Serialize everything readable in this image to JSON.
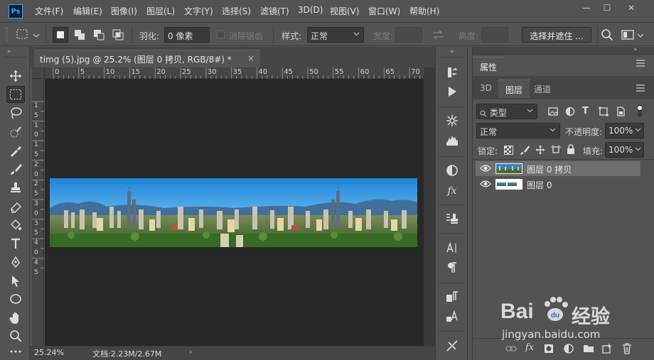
{
  "app": {
    "logo": "Ps"
  },
  "menu": [
    "文件(F)",
    "编辑(E)",
    "图像(I)",
    "图层(L)",
    "文字(Y)",
    "选择(S)",
    "滤镜(T)",
    "3D(D)",
    "视图(V)",
    "窗口(W)",
    "帮助(H)"
  ],
  "window_controls": {
    "minimize": "—",
    "maximize": "☐",
    "close": "✕"
  },
  "options": {
    "feather_label": "羽化:",
    "feather_value": "0 像素",
    "antialias_label": "消除锯齿",
    "style_label": "样式:",
    "style_value": "正常",
    "width_label": "宽度:",
    "height_label": "高度:",
    "select_mask_button": "选择并遮住 ..."
  },
  "document": {
    "tab_title": "timg (5).jpg @ 25.2% (图层 0 拷贝, RGB/8#) *",
    "tab_close": "×",
    "zoom": "25.24%",
    "doc_info": "文档:2.23M/2.67M",
    "status_arrow": "›"
  },
  "ruler": {
    "top_ticks": [
      "0",
      "5",
      "10",
      "15",
      "20",
      "25",
      "30",
      "35",
      "40",
      "45",
      "50",
      "55",
      "60",
      "65",
      "70"
    ],
    "left_ticks": [
      "1",
      "5",
      "1",
      "0",
      "1",
      "5",
      "2",
      "0",
      "2",
      "5",
      "3",
      "0",
      "3",
      "5",
      "4",
      "0",
      "4",
      "5"
    ]
  },
  "panels": {
    "properties_title": "属性",
    "tabs": [
      "3D",
      "图层",
      "通道"
    ],
    "active_tab": "图层",
    "filter_kind": "类型",
    "blend_mode": "正常",
    "opacity_label": "不透明度:",
    "opacity_value": "100%",
    "lock_label": "锁定:",
    "fill_label": "填充:",
    "fill_value": "100%",
    "layers": [
      {
        "name": "图层 0 拷贝",
        "selected": true,
        "visible": true
      },
      {
        "name": "图层 0",
        "selected": false,
        "visible": true
      }
    ]
  },
  "watermark": {
    "text": "jingyan.baidu.com",
    "brand": "Bai",
    "brand2": "经验"
  }
}
